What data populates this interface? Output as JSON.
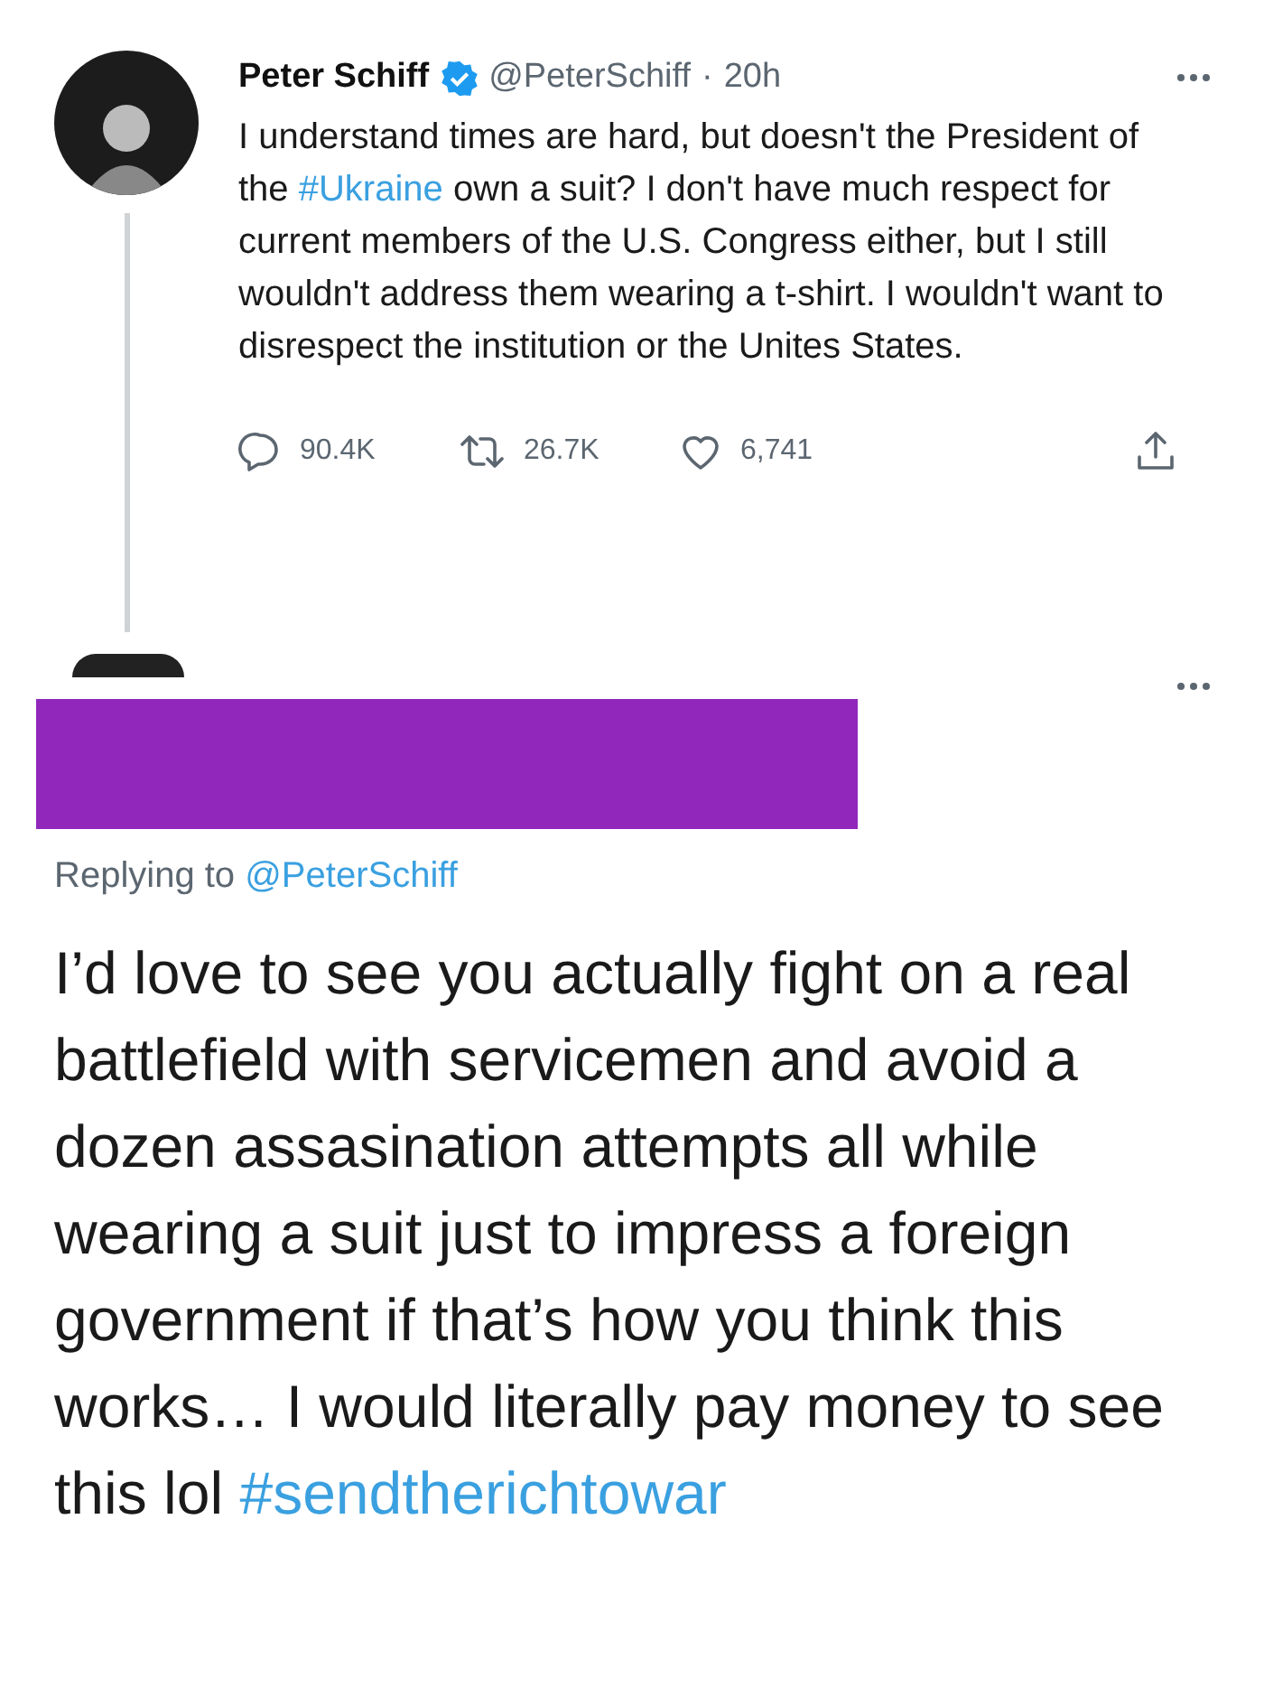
{
  "tweet": {
    "name": "Peter Schiff",
    "verified": true,
    "handle": "@PeterSchiff",
    "separator": "·",
    "time": "20h",
    "text": "I understand times are hard, but doesn't the President of the ",
    "hashtag": "#Ukraine",
    "text_end": " own a suit? I don't have much respect for current members of the U.S. Congress either, but I still wouldn't address them wearing a t-shirt. I wouldn't want to disrespect the institution or the Unites States.",
    "replies": "90.4K",
    "retweets": "26.7K",
    "likes": "6,741"
  },
  "reply": {
    "redacted": true,
    "replying_label": "Replying to ",
    "replying_to": "@PeterSchiff",
    "text": "I’d love to see you actually fight on a real battlefield with servicemen and avoid a dozen assasination attempts all while wearing a suit just to impress a foreign government if that’s how you think this works… I would literally pay money to see this lol ",
    "hashtag": "#sendtherichtowar"
  }
}
